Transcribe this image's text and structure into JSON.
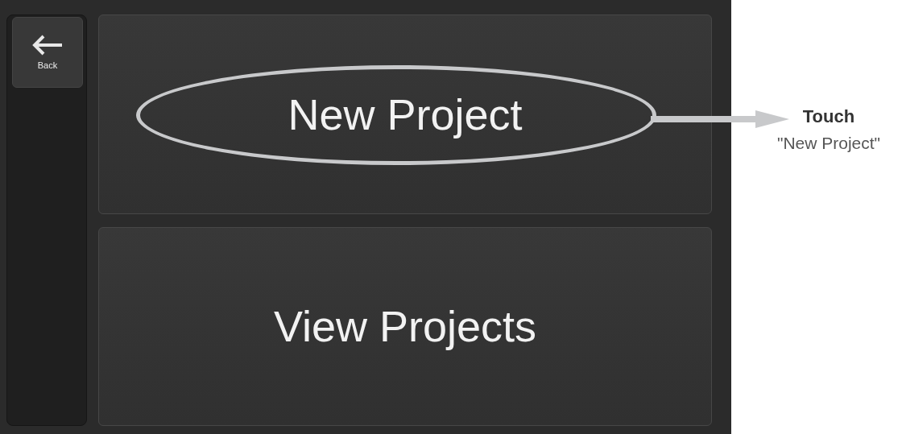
{
  "back_button": {
    "label": "Back"
  },
  "menu_buttons": [
    {
      "label": "New Project",
      "highlighted": true
    },
    {
      "label": "View Projects",
      "highlighted": false
    }
  ],
  "callout": {
    "action": "Touch",
    "target": "\"New Project\""
  }
}
